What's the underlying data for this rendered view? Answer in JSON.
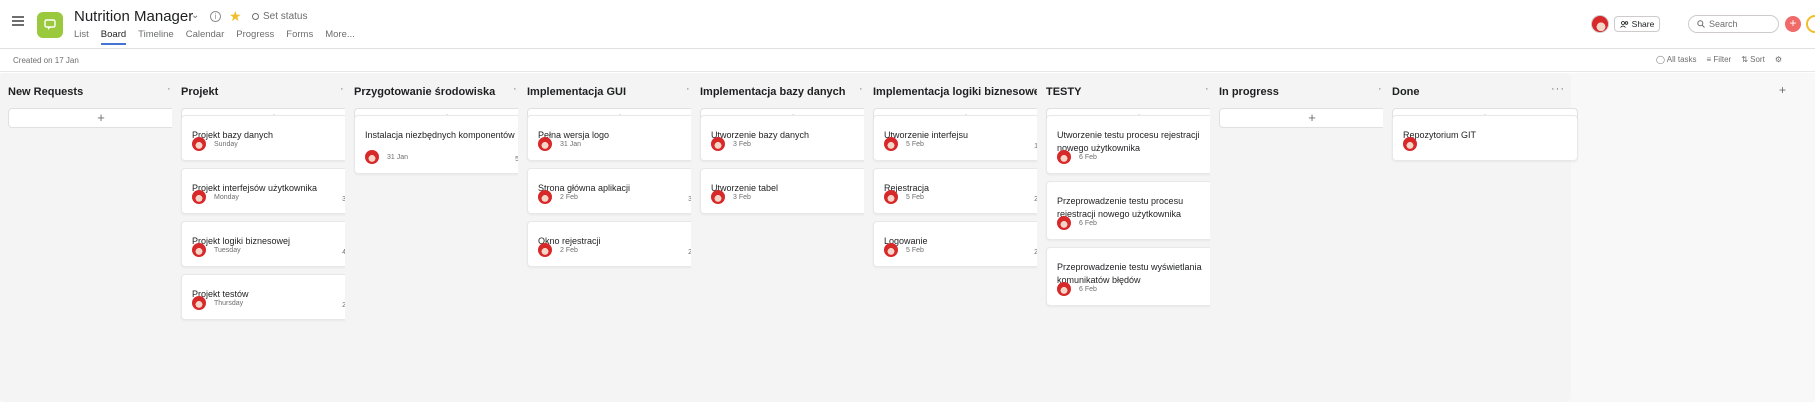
{
  "header": {
    "title": "Nutrition Manager",
    "set_status": "Set status",
    "tabs": [
      "List",
      "Board",
      "Timeline",
      "Calendar",
      "Progress",
      "Forms",
      "More..."
    ],
    "active_tab": "Board",
    "share": "Share",
    "search_placeholder": "Search",
    "app_color": "#9ac93d"
  },
  "subbar": {
    "created": "Created on 17 Jan",
    "all_tasks": "All tasks",
    "filter": "Filter",
    "sort": "Sort"
  },
  "columns": [
    {
      "title": "New Requests",
      "cards": []
    },
    {
      "title": "Projekt",
      "cards": [
        {
          "title": "Projekt bazy danych",
          "due": "Sunday",
          "subtasks": ""
        },
        {
          "title": "Projekt interfejsów użytkownika",
          "due": "Monday",
          "subtasks": "3"
        },
        {
          "title": "Projekt logiki biznesowej",
          "due": "Tuesday",
          "subtasks": "4"
        },
        {
          "title": "Projekt testów",
          "due": "Thursday",
          "subtasks": "2"
        }
      ]
    },
    {
      "title": "Przygotowanie środowiska",
      "cards": [
        {
          "title": "Instalacja niezbędnych komponentów",
          "due": "31 Jan",
          "subtasks": "5"
        }
      ]
    },
    {
      "title": "Implementacja GUI",
      "cards": [
        {
          "title": "Pełna wersja logo",
          "due": "31 Jan",
          "subtasks": ""
        },
        {
          "title": "Strona główna aplikacji",
          "due": "2 Feb",
          "subtasks": "3"
        },
        {
          "title": "Okno rejestracji",
          "due": "2 Feb",
          "subtasks": "2"
        }
      ]
    },
    {
      "title": "Implementacja bazy danych",
      "cards": [
        {
          "title": "Utworzenie bazy danych",
          "due": "3 Feb",
          "subtasks": ""
        },
        {
          "title": "Utworzenie tabel",
          "due": "3 Feb",
          "subtasks": ""
        }
      ]
    },
    {
      "title": "Implementacja logiki biznesowej",
      "cards": [
        {
          "title": "Utworzenie interfejsu",
          "due": "5 Feb",
          "subtasks": "1"
        },
        {
          "title": "Rejestracja",
          "due": "5 Feb",
          "subtasks": "2"
        },
        {
          "title": "Logowanie",
          "due": "5 Feb",
          "subtasks": "2"
        }
      ]
    },
    {
      "title": "TESTY",
      "cards": [
        {
          "title": "Utworzenie testu procesu rejestracji nowego użytkownika",
          "due": "6 Feb",
          "subtasks": ""
        },
        {
          "title": "Przeprowadzenie testu procesu rejestracji nowego użytkownika",
          "due": "6 Feb",
          "subtasks": ""
        },
        {
          "title": "Przeprowadzenie testu wyświetlania komunikatów błędów",
          "due": "6 Feb",
          "subtasks": ""
        }
      ]
    },
    {
      "title": "In progress",
      "cards": []
    },
    {
      "title": "Done",
      "cards": [
        {
          "title": "Repozytorium GIT",
          "due": "",
          "subtasks": ""
        }
      ]
    }
  ]
}
